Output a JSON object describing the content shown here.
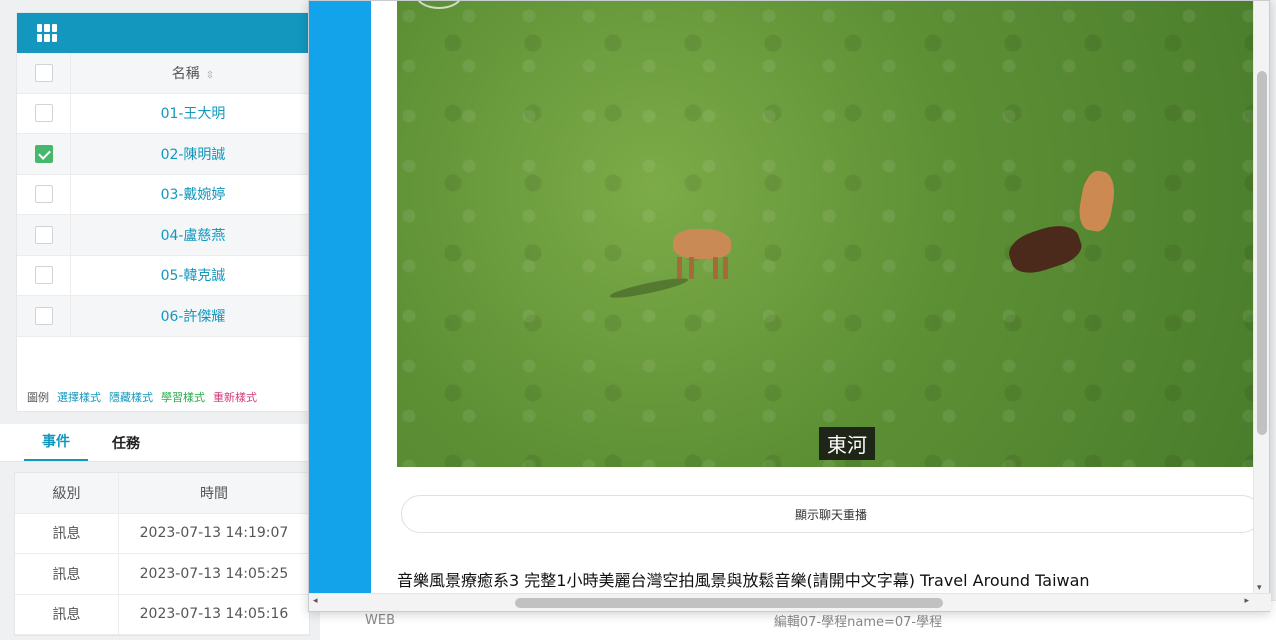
{
  "left_table": {
    "header": "名稱",
    "rows": [
      {
        "label": "01-王大明",
        "checked": false
      },
      {
        "label": "02-陳明誠",
        "checked": true
      },
      {
        "label": "03-戴婉婷",
        "checked": false
      },
      {
        "label": "04-盧慈燕",
        "checked": false
      },
      {
        "label": "05-韓克誠",
        "checked": false
      },
      {
        "label": "06-許傑耀",
        "checked": false
      }
    ],
    "legend": [
      {
        "label": "圖例",
        "color": "#555555"
      },
      {
        "label": "選擇樣式",
        "color": "#1497be"
      },
      {
        "label": "隱藏樣式",
        "color": "#1497be"
      },
      {
        "label": "學習樣式",
        "color": "#2aa84a"
      },
      {
        "label": "重新樣式",
        "color": "#d23b7a"
      }
    ]
  },
  "bottom_tabs": {
    "events": "事件",
    "tasks": "任務"
  },
  "log_table": {
    "col_level": "級別",
    "col_time": "時間",
    "rows": [
      {
        "level": "訊息",
        "time": "2023-07-13 14:19:07"
      },
      {
        "level": "訊息",
        "time": "2023-07-13 14:05:25"
      },
      {
        "level": "訊息",
        "time": "2023-07-13 14:05:16"
      }
    ]
  },
  "background_row": {
    "web": "WEB",
    "text": "編輯07-學程name=07-學程"
  },
  "popup": {
    "subtitle": "東河",
    "chat_button": "顯示聊天重播",
    "video_title": "音樂風景療癒系3 完整1小時美麗台灣空拍風景與放鬆音樂(請開中文字幕) Travel Around Taiwan"
  },
  "colors": {
    "accent": "#1497be",
    "popup_strip": "#12a3ea",
    "checked": "#46b86d"
  }
}
